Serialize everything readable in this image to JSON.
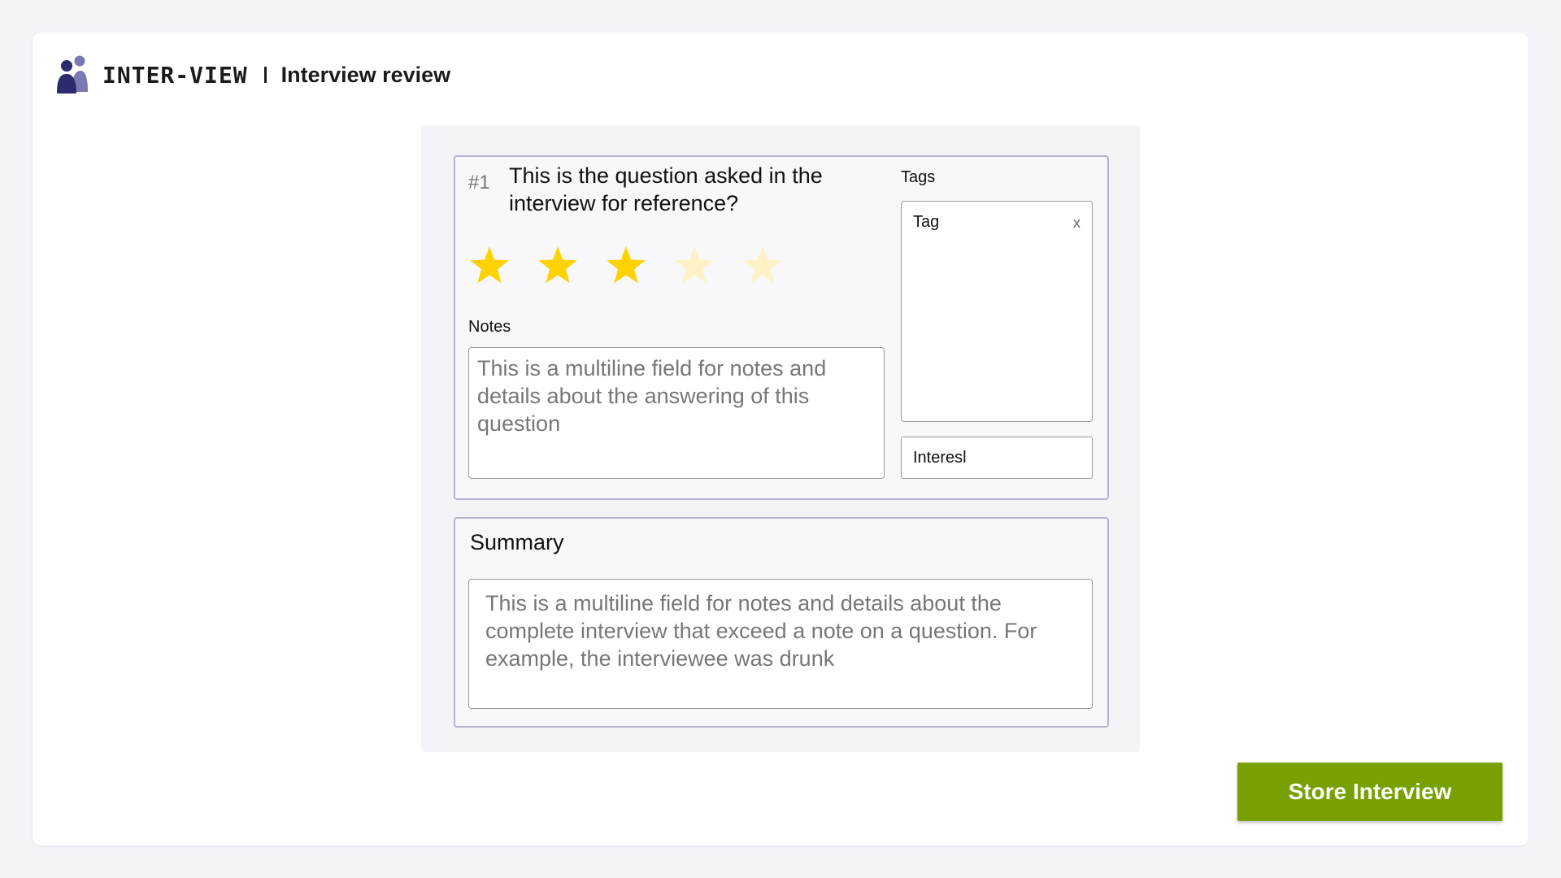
{
  "header": {
    "brand": "INTER-VIEW",
    "page_title": "Interview review",
    "logo_icon": "people-icon"
  },
  "question": {
    "number": "#1",
    "text": "This is the question asked in the interview for reference?",
    "rating": 3,
    "rating_max": 5,
    "star_filled_color": "#ffd200",
    "star_empty_color": "#fff2c6",
    "notes_label": "Notes",
    "notes_placeholder": "This is a multiline field for notes and details about the answering of this question"
  },
  "tags": {
    "label": "Tags",
    "items": [
      {
        "label": "Tag",
        "remove_label": "x"
      }
    ],
    "input_value": "Interesl"
  },
  "summary": {
    "title": "Summary",
    "placeholder": "This is a multiline field for notes and details about the complete interview that exceed a note on a question. For example, the interviewee was drunk"
  },
  "actions": {
    "store_label": "Store Interview",
    "store_color": "#77a000"
  }
}
